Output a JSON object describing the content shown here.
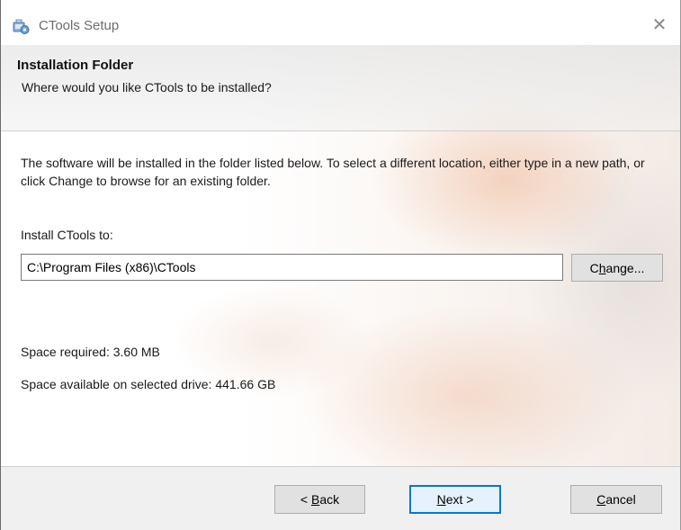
{
  "window": {
    "title": "CTools Setup",
    "app_icon": "setup-icon",
    "close_icon": "close-icon",
    "close_glyph": "✕"
  },
  "header": {
    "title": "Installation Folder",
    "subtitle": "Where would you like CTools to be installed?"
  },
  "body": {
    "description": "The software will be installed in the folder listed below. To select a different location, either type in a new path, or click Change to browse for an existing folder.",
    "install_label": "Install CTools to:",
    "install_path": "C:\\Program Files (x86)\\CTools",
    "change_button": {
      "pre": "C",
      "accel": "h",
      "post": "ange..."
    },
    "space_required": "Space required: 3.60 MB",
    "space_available": "Space available on selected drive: 441.66 GB"
  },
  "footer": {
    "back_button": {
      "pre": "< ",
      "accel": "B",
      "post": "ack"
    },
    "next_button": {
      "pre": "",
      "accel": "N",
      "post": "ext >"
    },
    "cancel_button": {
      "pre": "",
      "accel": "C",
      "post": "ancel"
    }
  },
  "colors": {
    "accent": "#0078d7",
    "footer_bg": "#f0f0f0",
    "button_bg": "#e1e1e1"
  }
}
